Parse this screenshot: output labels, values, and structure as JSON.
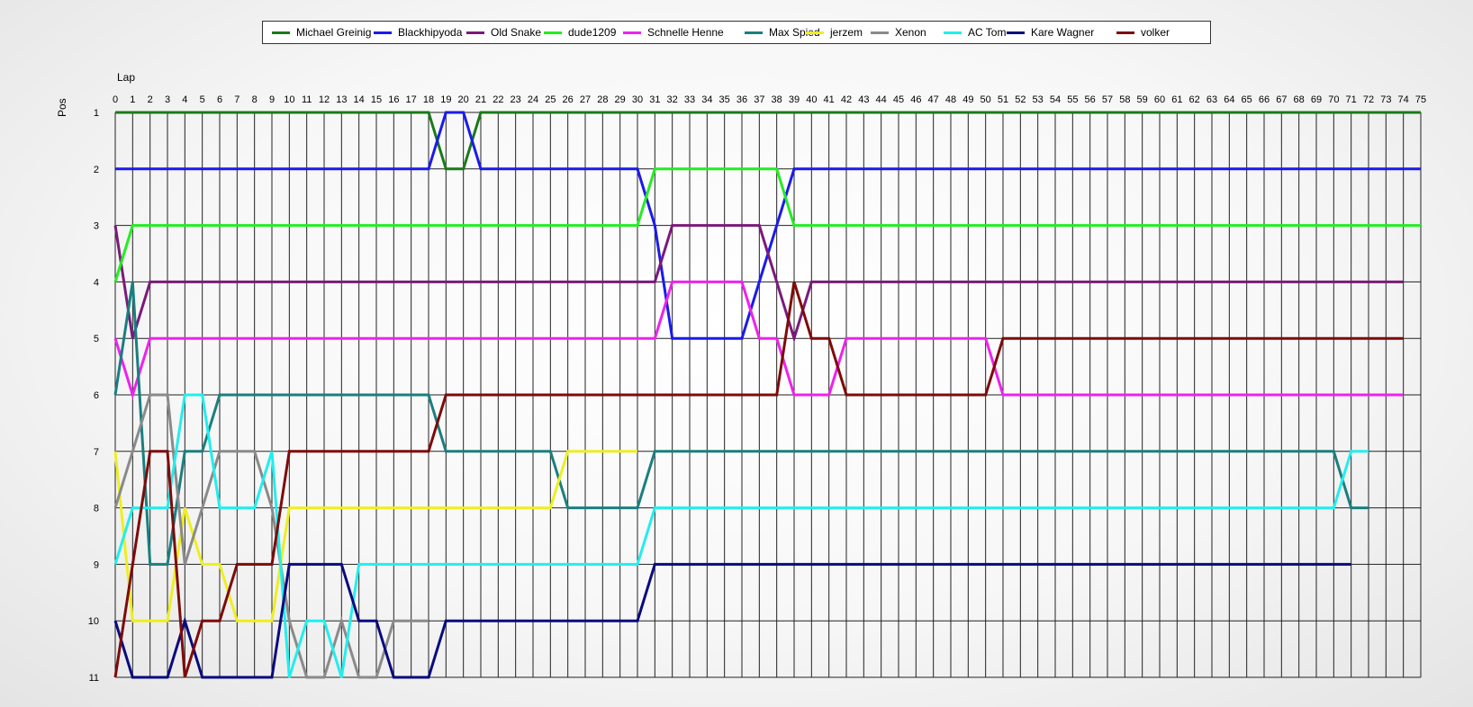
{
  "chart_data": {
    "type": "line",
    "xlabel": "Lap",
    "ylabel": "Pos",
    "x_ticks": [
      0,
      1,
      2,
      3,
      4,
      5,
      6,
      7,
      8,
      9,
      10,
      11,
      12,
      13,
      14,
      15,
      16,
      17,
      18,
      19,
      20,
      21,
      22,
      23,
      24,
      25,
      26,
      27,
      28,
      29,
      30,
      31,
      32,
      33,
      34,
      35,
      36,
      37,
      38,
      39,
      40,
      41,
      42,
      43,
      44,
      45,
      46,
      47,
      48,
      49,
      50,
      51,
      52,
      53,
      54,
      55,
      56,
      57,
      58,
      59,
      60,
      61,
      62,
      63,
      64,
      65,
      66,
      67,
      68,
      69,
      70,
      71,
      72,
      73,
      74,
      75
    ],
    "y_ticks": [
      1,
      2,
      3,
      4,
      5,
      6,
      7,
      8,
      9,
      10,
      11
    ],
    "xlim": [
      0,
      75
    ],
    "ylim": [
      1,
      11
    ],
    "y_inverted": true,
    "grid": true,
    "legend_position": "top",
    "series": [
      {
        "name": "Michael Greinig",
        "color": "#1a7a1a",
        "points": [
          [
            0,
            1
          ],
          [
            18,
            1
          ],
          [
            19,
            2
          ],
          [
            20,
            2
          ],
          [
            21,
            1
          ],
          [
            75,
            1
          ]
        ]
      },
      {
        "name": "Blackhipyoda",
        "color": "#1a1aee",
        "points": [
          [
            0,
            2
          ],
          [
            18,
            2
          ],
          [
            19,
            1
          ],
          [
            20,
            1
          ],
          [
            21,
            2
          ],
          [
            30,
            2
          ],
          [
            31,
            3
          ],
          [
            32,
            5
          ],
          [
            36,
            5
          ],
          [
            37,
            4
          ],
          [
            38,
            3
          ],
          [
            39,
            2
          ],
          [
            75,
            2
          ]
        ]
      },
      {
        "name": "Old Snake",
        "color": "#7a1a7a",
        "points": [
          [
            0,
            3
          ],
          [
            1,
            5
          ],
          [
            2,
            4
          ],
          [
            31,
            4
          ],
          [
            32,
            3
          ],
          [
            37,
            3
          ],
          [
            38,
            4
          ],
          [
            39,
            5
          ],
          [
            40,
            4
          ],
          [
            74,
            4
          ]
        ]
      },
      {
        "name": "dude1209",
        "color": "#22ee22",
        "points": [
          [
            0,
            4
          ],
          [
            1,
            3
          ],
          [
            30,
            3
          ],
          [
            31,
            2
          ],
          [
            38,
            2
          ],
          [
            39,
            3
          ],
          [
            75,
            3
          ]
        ]
      },
      {
        "name": "Schnelle Henne",
        "color": "#ee22ee",
        "points": [
          [
            0,
            5
          ],
          [
            1,
            6
          ],
          [
            2,
            5
          ],
          [
            31,
            5
          ],
          [
            32,
            4
          ],
          [
            36,
            4
          ],
          [
            37,
            5
          ],
          [
            38,
            5
          ],
          [
            39,
            6
          ],
          [
            41,
            6
          ],
          [
            42,
            5
          ],
          [
            50,
            5
          ],
          [
            51,
            6
          ],
          [
            74,
            6
          ]
        ]
      },
      {
        "name": "Max Spied",
        "color": "#1a7f7f",
        "points": [
          [
            0,
            6
          ],
          [
            1,
            4
          ],
          [
            2,
            9
          ],
          [
            3,
            9
          ],
          [
            4,
            7
          ],
          [
            5,
            7
          ],
          [
            6,
            6
          ],
          [
            18,
            6
          ],
          [
            19,
            7
          ],
          [
            25,
            7
          ],
          [
            26,
            8
          ],
          [
            30,
            8
          ],
          [
            31,
            7
          ],
          [
            70,
            7
          ],
          [
            71,
            8
          ],
          [
            72,
            8
          ]
        ]
      },
      {
        "name": "jerzem",
        "color": "#eeee22",
        "points": [
          [
            0,
            7
          ],
          [
            1,
            10
          ],
          [
            3,
            10
          ],
          [
            4,
            8
          ],
          [
            5,
            9
          ],
          [
            6,
            9
          ],
          [
            7,
            10
          ],
          [
            9,
            10
          ],
          [
            10,
            8
          ],
          [
            25,
            8
          ],
          [
            26,
            7
          ],
          [
            30,
            7
          ]
        ]
      },
      {
        "name": "Xenon",
        "color": "#8a8a8a",
        "points": [
          [
            0,
            8
          ],
          [
            1,
            7
          ],
          [
            2,
            6
          ],
          [
            3,
            6
          ],
          [
            4,
            9
          ],
          [
            5,
            8
          ],
          [
            6,
            7
          ],
          [
            8,
            7
          ],
          [
            9,
            8
          ],
          [
            10,
            10
          ],
          [
            11,
            11
          ],
          [
            12,
            11
          ],
          [
            13,
            10
          ],
          [
            14,
            11
          ],
          [
            15,
            11
          ],
          [
            16,
            10
          ],
          [
            18,
            10
          ]
        ]
      },
      {
        "name": "AC Tom",
        "color": "#22eeee",
        "points": [
          [
            0,
            9
          ],
          [
            1,
            8
          ],
          [
            3,
            8
          ],
          [
            4,
            6
          ],
          [
            5,
            6
          ],
          [
            6,
            8
          ],
          [
            8,
            8
          ],
          [
            9,
            7
          ],
          [
            10,
            11
          ],
          [
            11,
            10
          ],
          [
            12,
            10
          ],
          [
            13,
            11
          ],
          [
            14,
            9
          ],
          [
            30,
            9
          ],
          [
            31,
            8
          ],
          [
            70,
            8
          ],
          [
            71,
            7
          ],
          [
            72,
            7
          ]
        ]
      },
      {
        "name": "Kare Wagner",
        "color": "#0a0a7f",
        "points": [
          [
            0,
            10
          ],
          [
            1,
            11
          ],
          [
            3,
            11
          ],
          [
            4,
            10
          ],
          [
            5,
            11
          ],
          [
            9,
            11
          ],
          [
            10,
            9
          ],
          [
            13,
            9
          ],
          [
            14,
            10
          ],
          [
            15,
            10
          ],
          [
            16,
            11
          ],
          [
            18,
            11
          ],
          [
            19,
            10
          ],
          [
            30,
            10
          ],
          [
            31,
            9
          ],
          [
            71,
            9
          ]
        ]
      },
      {
        "name": "volker",
        "color": "#7f0a0a",
        "points": [
          [
            0,
            11
          ],
          [
            2,
            7
          ],
          [
            3,
            7
          ],
          [
            4,
            11
          ],
          [
            5,
            10
          ],
          [
            6,
            10
          ],
          [
            7,
            9
          ],
          [
            9,
            9
          ],
          [
            10,
            7
          ],
          [
            18,
            7
          ],
          [
            19,
            6
          ],
          [
            38,
            6
          ],
          [
            39,
            4
          ],
          [
            40,
            5
          ],
          [
            41,
            5
          ],
          [
            42,
            6
          ],
          [
            50,
            6
          ],
          [
            51,
            5
          ],
          [
            74,
            5
          ]
        ]
      }
    ]
  }
}
